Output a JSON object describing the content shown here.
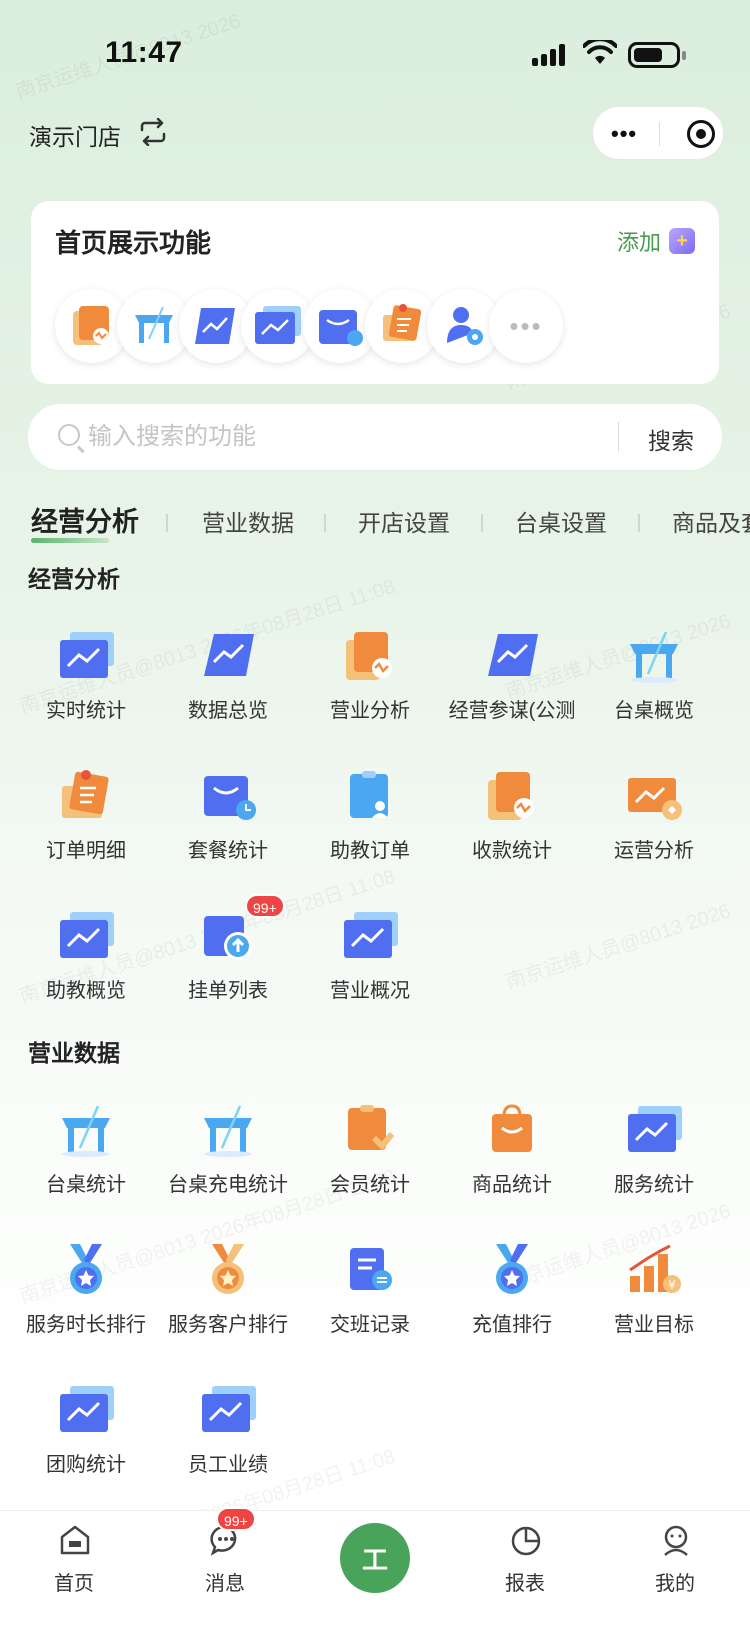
{
  "status_bar": {
    "time": "11:47"
  },
  "header": {
    "store_name": "演示门店"
  },
  "favorites": {
    "title": "首页展示功能",
    "add_label": "添加",
    "icons": [
      "order-doc-icon",
      "table-icon",
      "chart-icon",
      "chart-icon",
      "package-icon",
      "order-detail-icon",
      "user-settings-icon"
    ]
  },
  "search": {
    "placeholder": "输入搜索的功能",
    "button": "搜索"
  },
  "tabs": [
    "经营分析",
    "营业数据",
    "开店设置",
    "台桌设置",
    "商品及套"
  ],
  "sections": [
    {
      "title": "经营分析",
      "items": [
        {
          "label": "实时统计",
          "icon": "chart-icon"
        },
        {
          "label": "数据总览",
          "icon": "chart-tilt-icon"
        },
        {
          "label": "营业分析",
          "icon": "order-doc-icon"
        },
        {
          "label": "经营参谋(公测",
          "icon": "chart-tilt-icon"
        },
        {
          "label": "台桌概览",
          "icon": "table-icon"
        },
        {
          "label": "订单明细",
          "icon": "order-detail-icon"
        },
        {
          "label": "套餐统计",
          "icon": "package-icon"
        },
        {
          "label": "助教订单",
          "icon": "assistant-icon"
        },
        {
          "label": "收款统计",
          "icon": "order-doc-icon"
        },
        {
          "label": "运营分析",
          "icon": "operation-icon"
        },
        {
          "label": "助教概览",
          "icon": "chart-icon"
        },
        {
          "label": "挂单列表",
          "icon": "upload-icon",
          "badge": "99+"
        },
        {
          "label": "营业概况",
          "icon": "chart-icon"
        }
      ]
    },
    {
      "title": "营业数据",
      "items": [
        {
          "label": "台桌统计",
          "icon": "table-icon"
        },
        {
          "label": "台桌充电统计",
          "icon": "table-icon"
        },
        {
          "label": "会员统计",
          "icon": "member-icon"
        },
        {
          "label": "商品统计",
          "icon": "bag-icon"
        },
        {
          "label": "服务统计",
          "icon": "chart-icon"
        },
        {
          "label": "服务时长排行",
          "icon": "medal-blue-icon"
        },
        {
          "label": "服务客户排行",
          "icon": "medal-orange-icon"
        },
        {
          "label": "交班记录",
          "icon": "shift-icon"
        },
        {
          "label": "充值排行",
          "icon": "medal-blue-icon"
        },
        {
          "label": "营业目标",
          "icon": "target-bars-icon"
        },
        {
          "label": "团购统计",
          "icon": "chart-icon"
        },
        {
          "label": "员工业绩",
          "icon": "chart-icon"
        }
      ]
    }
  ],
  "bottom_nav": {
    "home": "首页",
    "messages": "消息",
    "messages_badge": "99+",
    "workbench_text": "工",
    "reports": "报表",
    "mine": "我的"
  },
  "colors": {
    "brand_green": "#4aa35a",
    "badge_red": "#ee4444",
    "icon_blue": "#4f6ef0",
    "icon_orange": "#f08a3c"
  }
}
